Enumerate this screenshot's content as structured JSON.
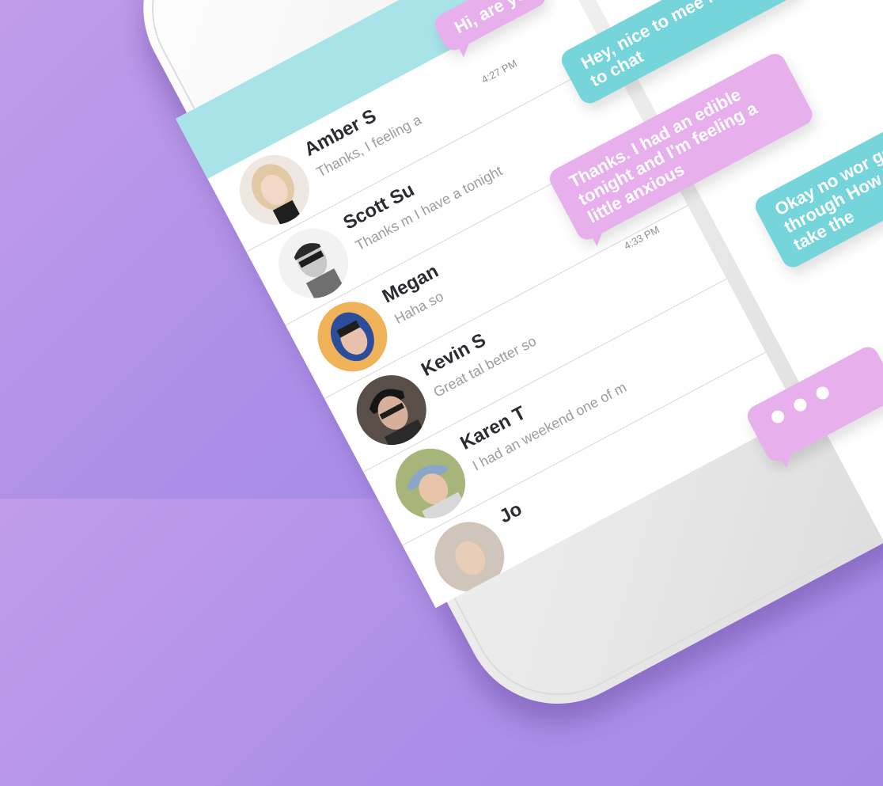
{
  "contacts": [
    {
      "name": "Amber S",
      "preview": "Thanks, I feeling a"
    },
    {
      "name": "Scott Su",
      "preview": "Thanks m I have a tonight"
    },
    {
      "name": "Megan",
      "preview": "Haha so"
    },
    {
      "name": "Kevin S",
      "preview": "Great tal better so"
    },
    {
      "name": "Karen T",
      "preview": "I had an weekend one of m"
    },
    {
      "name": "Jo",
      "preview": ""
    }
  ],
  "chat": {
    "messages": [
      {
        "text": "Hi, are yo",
        "side": "incoming"
      },
      {
        "text": "Hey, nice to mee I'd love to chat",
        "side": "outgoing"
      },
      {
        "text": "Thanks. I had an edible tonight and I'm feeling a little anxious",
        "side": "incoming"
      },
      {
        "text": "Okay no wor get through How long take the",
        "side": "outgoing"
      }
    ],
    "timestamps": [
      "4:27 PM",
      "4:33 PM"
    ],
    "typing_indicator": "..."
  },
  "colors": {
    "background": "#b193e6",
    "header": "#a8e3e8",
    "incoming_bubble": "#e7b0ec",
    "outgoing_bubble": "#75d5da"
  }
}
